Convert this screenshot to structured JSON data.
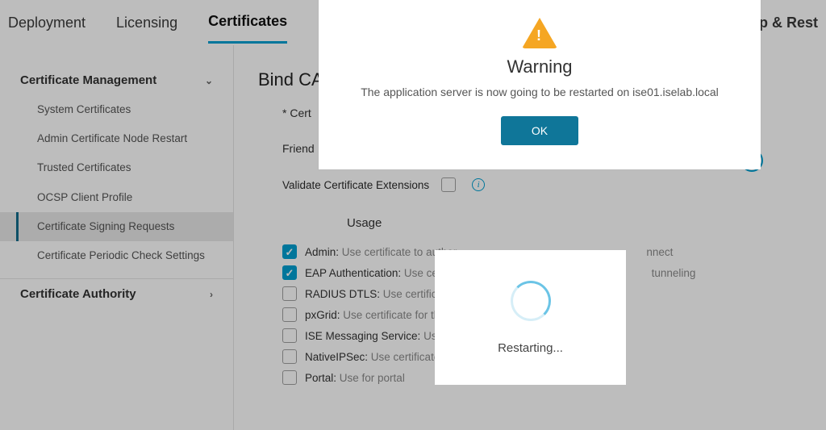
{
  "tabs": {
    "deployment": "Deployment",
    "licensing": "Licensing",
    "certificates": "Certificates",
    "right_partial": "up & Rest"
  },
  "sidebar": {
    "group1": "Certificate Management",
    "items": [
      "System Certificates",
      "Admin Certificate Node Restart",
      "Trusted Certificates",
      "OCSP Client Profile",
      "Certificate Signing Requests",
      "Certificate Periodic Check Settings"
    ],
    "group2": "Certificate Authority"
  },
  "content": {
    "title": "Bind CA S",
    "cert_label": "* Cert",
    "friendly_label": "Friend",
    "validate_label": "Validate Certificate Extensions",
    "usage_label": "Usage",
    "usages": [
      {
        "checked": true,
        "name": "Admin:",
        "desc": " Use certificate to auther",
        "desc_after": "nnect"
      },
      {
        "checked": true,
        "name": "EAP Authentication:",
        "desc": " Use certific",
        "desc_after": " tunneling"
      },
      {
        "checked": false,
        "name": "RADIUS DTLS:",
        "desc": " Use certificate fo",
        "desc_after": ""
      },
      {
        "checked": false,
        "name": "pxGrid:",
        "desc": " Use certificate for the p",
        "desc_after": ""
      },
      {
        "checked": false,
        "name": "ISE Messaging Service:",
        "desc": " Use cer",
        "desc_after": ""
      },
      {
        "checked": false,
        "name": "NativeIPSec:",
        "desc": " Use certificate for",
        "desc_after": ""
      },
      {
        "checked": false,
        "name": "Portal:",
        "desc": " Use for portal",
        "desc_after": ""
      }
    ]
  },
  "modal": {
    "title": "Warning",
    "message": "The application server is now going to be restarted on ise01.iselab.local",
    "ok": "OK"
  },
  "restart": {
    "text": "Restarting..."
  }
}
